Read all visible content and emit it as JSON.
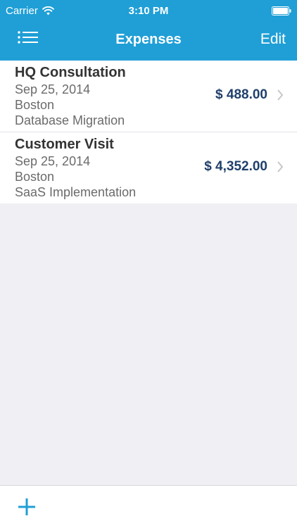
{
  "status_bar": {
    "carrier": "Carrier",
    "time": "3:10 PM",
    "icons": [
      "wifi-icon",
      "battery-icon"
    ]
  },
  "nav": {
    "title": "Expenses",
    "edit_label": "Edit",
    "menu_icon": "list-menu-icon"
  },
  "expenses": [
    {
      "title": "HQ Consultation",
      "date": "Sep 25, 2014",
      "location": "Boston",
      "project": "Database Migration",
      "amount": "$ 488.00"
    },
    {
      "title": "Customer Visit",
      "date": "Sep 25, 2014",
      "location": "Boston",
      "project": "SaaS Implementation",
      "amount": "$ 4,352.00"
    }
  ],
  "toolbar": {
    "add_icon": "plus-icon"
  },
  "colors": {
    "accent": "#1f9fd6",
    "amount": "#1f3f6a",
    "background": "#efeff4"
  }
}
